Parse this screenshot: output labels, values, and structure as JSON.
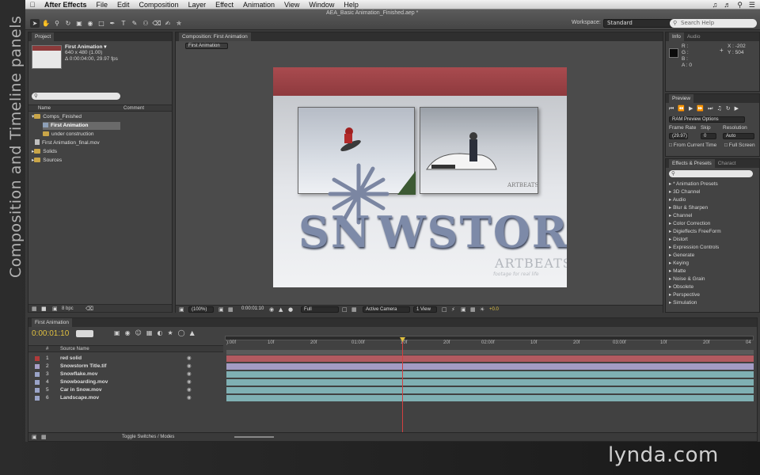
{
  "side_title": "Composition and Timeline panels",
  "menubar": {
    "apple_icon": "apple-icon",
    "app_name": "After Effects",
    "items": [
      "File",
      "Edit",
      "Composition",
      "Layer",
      "Effect",
      "Animation",
      "View",
      "Window",
      "Help"
    ]
  },
  "toolbar": {
    "document_title": "AEA_Basic Animation_Finished.aep *",
    "workspace_label": "Workspace:",
    "workspace_value": "Standard",
    "search_placeholder": "Search Help"
  },
  "project_panel": {
    "tab": "Project",
    "item_name": "First Animation ▾",
    "item_size": "640 x 480 (1.00)",
    "item_duration": "Δ 0:00:04:00, 29.97 fps",
    "col_name": "Name",
    "col_comment": "Comment",
    "rows": [
      "Comps_Finished",
      "First Animation",
      "under construction",
      "First Animation_final.mov",
      "Solids",
      "Sources"
    ],
    "bpc": "8 bpc"
  },
  "comp_panel": {
    "tab": "Composition: First Animation",
    "breadcrumb": "First Animation",
    "zoom": "(100%)",
    "timecode": "0:00:01:10",
    "resolution": "Full",
    "camera": "Active Camera",
    "view": "1 View",
    "exposure": "+0.0"
  },
  "canvas": {
    "title_part1": "SN",
    "title_part2": "WSTORM",
    "watermark": "ARTBEATS",
    "watermark_sub": "footage for real life"
  },
  "info_panel": {
    "tabs": [
      "Info",
      "Audio"
    ],
    "r": "R :",
    "g": "G :",
    "b": "B :",
    "a": "A : 0",
    "x": "X : -202",
    "y": "Y : 504"
  },
  "preview_panel": {
    "tab": "Preview",
    "ram_options": "RAM Preview Options",
    "frame_rate_label": "Frame Rate",
    "skip_label": "Skip",
    "resolution_label": "Resolution",
    "frame_rate": "(29.97)",
    "skip": "0",
    "resolution": "Auto",
    "from_current": "From Current Time",
    "full_screen": "Full Screen"
  },
  "effects_panel": {
    "tabs": [
      "Effects & Presets",
      "Charact"
    ],
    "items": [
      "* Animation Presets",
      "3D Channel",
      "Audio",
      "Blur & Sharpen",
      "Channel",
      "Color Correction",
      "Digieffects FreeForm",
      "Distort",
      "Expression Controls",
      "Generate",
      "Keying",
      "Matte",
      "Noise & Grain",
      "Obsolete",
      "Perspective",
      "Simulation"
    ]
  },
  "timeline": {
    "tab": "First Animation",
    "timecode": "0:00:01:10",
    "col_num": "#",
    "col_source": "Source Name",
    "ruler": [
      "):00f",
      "10f",
      "20f",
      "01:00f",
      "10f",
      "20f",
      "02:00f",
      "10f",
      "20f",
      "03:00f",
      "10f",
      "20f",
      "04"
    ],
    "layers": [
      {
        "num": "1",
        "name": "red solid",
        "color": "#b03a3a"
      },
      {
        "num": "2",
        "name": "Snowstorm Title.tif",
        "color": "#a8a0c8"
      },
      {
        "num": "3",
        "name": "Snowflake.mov",
        "color": "#9aa4c8"
      },
      {
        "num": "4",
        "name": "Snowboarding.mov",
        "color": "#9aa4c8"
      },
      {
        "num": "5",
        "name": "Car in Snow.mov",
        "color": "#9aa4c8"
      },
      {
        "num": "6",
        "name": "Landscape.mov",
        "color": "#9aa4c8"
      }
    ],
    "toggle_label": "Toggle Switches / Modes"
  },
  "watermark_brand": "lynda.com",
  "colors": {
    "panel_bg": "#434343",
    "tab_bg": "#2f2f2f",
    "timecode_yellow": "#e0c040",
    "playhead": "#d24040",
    "layer_bar_teal": "#7fb0b3",
    "layer_bar_red": "#b25a60",
    "layer_bar_lavender": "#a39cc4"
  }
}
